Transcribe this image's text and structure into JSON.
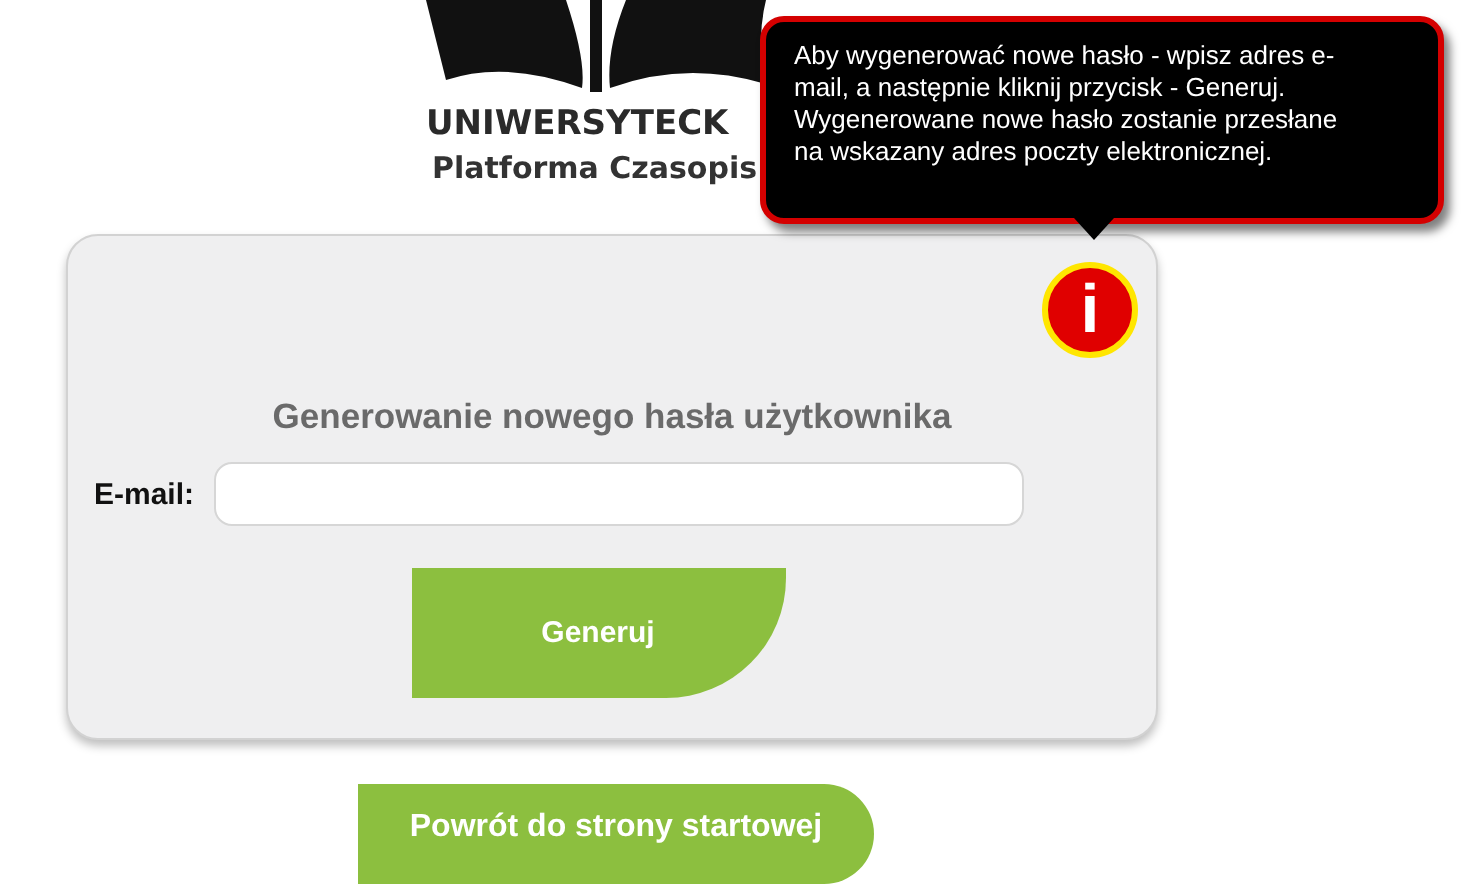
{
  "logo": {
    "line_1": "UNIWERSYTECK",
    "line_2": "Platforma Czasopis"
  },
  "tooltip": {
    "text": "Aby wygenerować nowe hasło - wpisz adres e-mail, a następnie kliknij przycisk - Generuj. Wygenerowane nowe hasło zostanie przesłane na wskazany adres poczty elektronicznej."
  },
  "info_icon": {
    "glyph": "i"
  },
  "form": {
    "title": "Generowanie nowego hasła użytkownika",
    "email_label": "E-mail:",
    "submit": "Generuj"
  },
  "back_button": "Powrót do strony startowej"
}
